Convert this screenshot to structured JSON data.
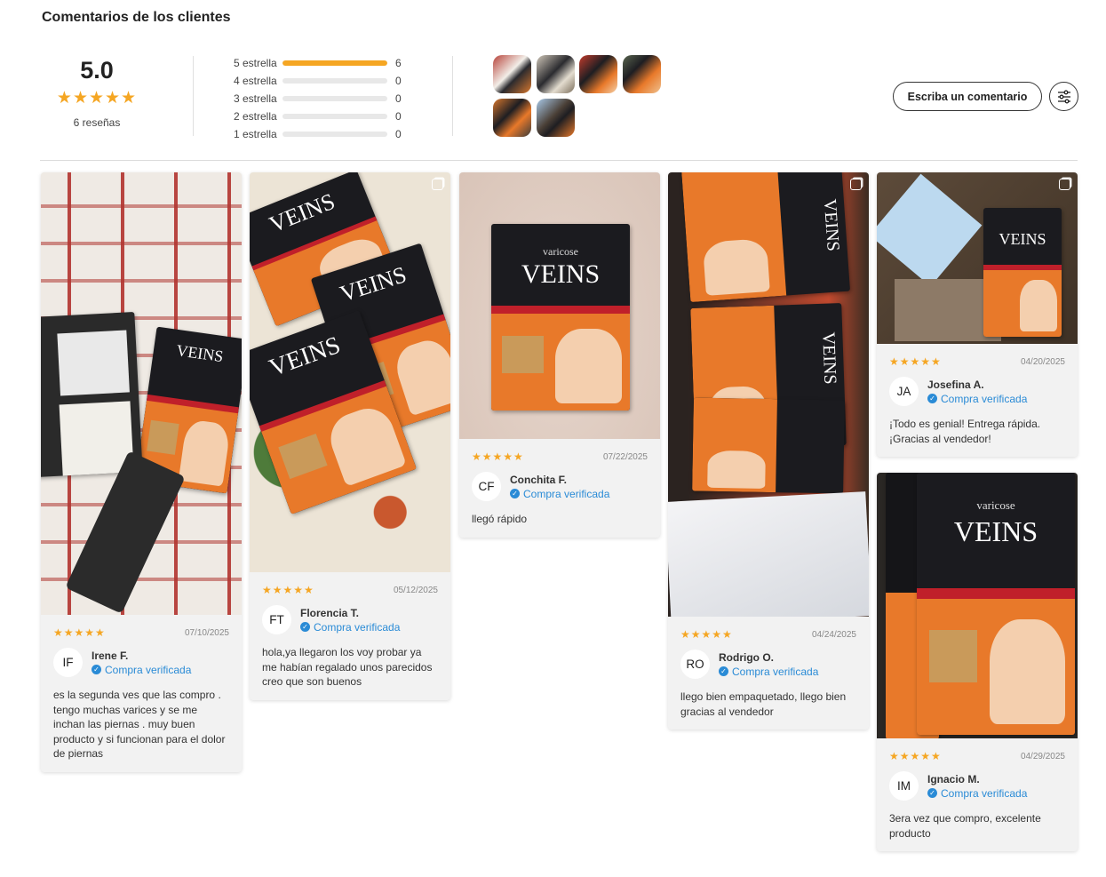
{
  "header": {
    "title": "Comentarios de los clientes"
  },
  "summary": {
    "score": "5.0",
    "stars": "★★★★★",
    "review_count": "6 reseñas",
    "distribution": [
      {
        "label": "5 estrella",
        "count": "6",
        "fraction": 1.0
      },
      {
        "label": "4 estrella",
        "count": "0",
        "fraction": 0
      },
      {
        "label": "3 estrella",
        "count": "0",
        "fraction": 0
      },
      {
        "label": "2 estrella",
        "count": "0",
        "fraction": 0
      },
      {
        "label": "1 estrella",
        "count": "0",
        "fraction": 0
      }
    ],
    "photo_thumbnails": 6
  },
  "actions": {
    "write_review": "Escriba un comentario",
    "filter_icon": "sliders-icon"
  },
  "reviews": [
    {
      "stars": "★★★★★",
      "date": "07/10/2025",
      "initials": "IF",
      "name": "Irene F.",
      "verified": "Compra verificada",
      "text": "es la segunda ves que las compro . tengo muchas varices y se me inchan las piernas . muy buen producto y si funcionan para el dolor de piernas"
    },
    {
      "stars": "★★★★★",
      "date": "05/12/2025",
      "initials": "FT",
      "name": "Florencia T.",
      "verified": "Compra verificada",
      "text": "hola,ya llegaron los voy probar ya me habían regalado unos parecidos creo que son buenos"
    },
    {
      "stars": "★★★★★",
      "date": "07/22/2025",
      "initials": "CF",
      "name": "Conchita F.",
      "verified": "Compra verificada",
      "text": "llegó rápido"
    },
    {
      "stars": "★★★★★",
      "date": "04/24/2025",
      "initials": "RO",
      "name": "Rodrigo O.",
      "verified": "Compra verificada",
      "text": "llego bien empaquetado, llego bien gracias al vendedor"
    },
    {
      "stars": "★★★★★",
      "date": "04/20/2025",
      "initials": "JA",
      "name": "Josefina A.",
      "verified": "Compra verificada",
      "text": "¡Todo es genial! Entrega rápida. ¡Gracias al vendedor!"
    },
    {
      "stars": "★★★★★",
      "date": "04/29/2025",
      "initials": "IM",
      "name": "Ignacio M.",
      "verified": "Compra verificada",
      "text": "3era vez que compro, excelente producto"
    }
  ],
  "product": {
    "brand": "VEINS",
    "sub": "varicose"
  },
  "colors": {
    "star": "#f5a623",
    "verified": "#2a8bd6",
    "packet": "#1b1b1f",
    "packet_orange": "#e8792a"
  }
}
